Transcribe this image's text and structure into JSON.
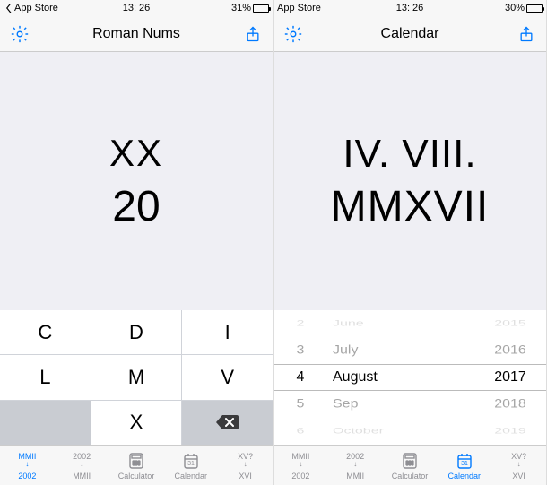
{
  "left": {
    "status": {
      "back_label": "App Store",
      "time": "13: 26",
      "battery_pct": "31%",
      "battery_fill": 31
    },
    "nav": {
      "title": "Roman Nums"
    },
    "display": {
      "roman": "XX",
      "arabic": "20"
    },
    "keys": {
      "c": "C",
      "d": "D",
      "i": "I",
      "l": "L",
      "m": "M",
      "v": "V",
      "x": "X"
    }
  },
  "right": {
    "status": {
      "back_label": "App Store",
      "time": "13: 26",
      "battery_pct": "30%",
      "battery_fill": 30
    },
    "nav": {
      "title": "Calendar"
    },
    "display": {
      "line1": "IV. VIII.",
      "line2": "MMXVII"
    },
    "picker": {
      "days": [
        "2",
        "3",
        "4",
        "5",
        "6"
      ],
      "months": [
        "June",
        "July",
        "August",
        "Sep",
        "October"
      ],
      "years": [
        "2015",
        "2016",
        "2017",
        "2018",
        "2019"
      ]
    }
  },
  "tabs": {
    "t1_top": "MMII",
    "t1_label": "2002",
    "t2_top": "2002",
    "t2_label": "MMII",
    "t3_label": "Calculator",
    "t4_num": "31",
    "t4_label": "Calendar",
    "t5_top": "XV?",
    "t5_label": "XVI"
  }
}
